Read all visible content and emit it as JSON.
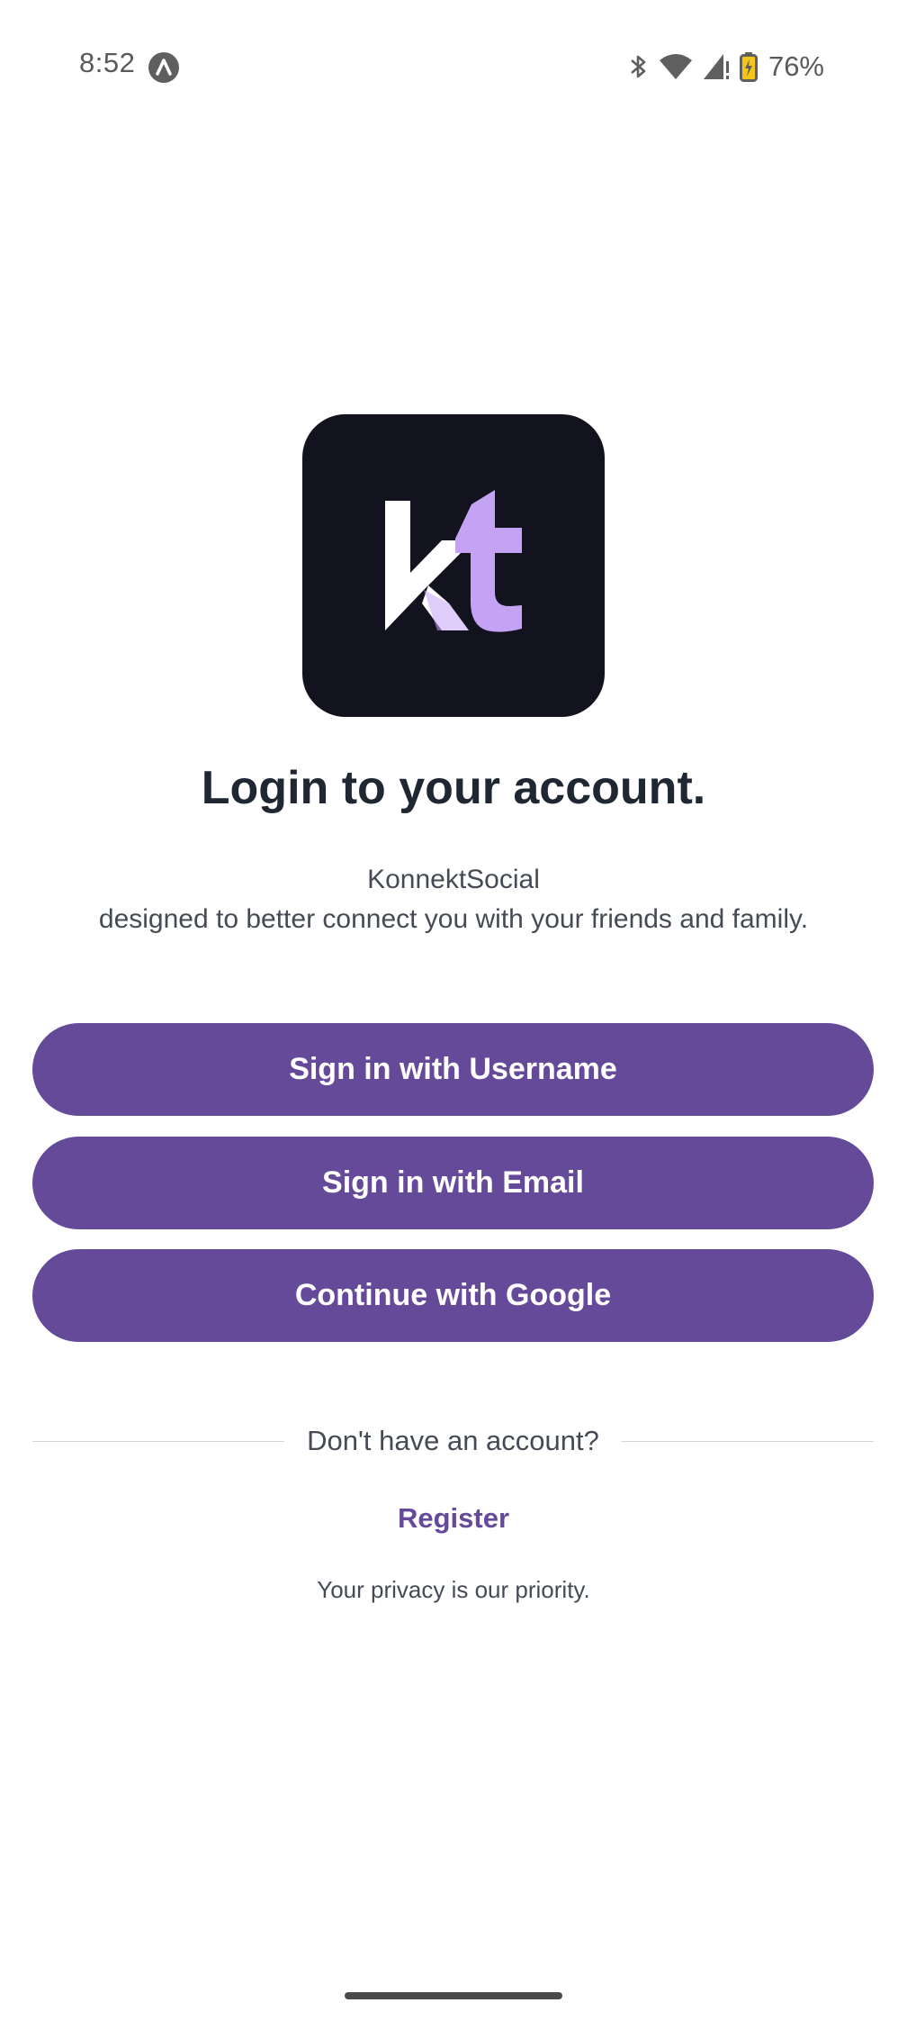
{
  "status_bar": {
    "time": "8:52",
    "battery_percent": "76%",
    "icons": [
      "app-notification-icon",
      "bluetooth-icon",
      "wifi-icon",
      "cellular-signal-icon",
      "battery-charging-icon"
    ]
  },
  "logo": {
    "letters": "kt",
    "colors": {
      "background": "#13121f",
      "k": "#ffffff",
      "t": "#c4a3f5"
    }
  },
  "title": "Login to your account.",
  "tagline": {
    "line1": "KonnektSocial",
    "line2": "designed to better connect you with your friends and family."
  },
  "buttons": {
    "username": "Sign in with Username",
    "email": "Sign in with Email",
    "google": "Continue with Google"
  },
  "divider_text": "Don't have an account?",
  "register_label": "Register",
  "privacy_note": "Your privacy is our priority.",
  "colors": {
    "accent": "#654a9a",
    "text_primary": "#1f2733",
    "text_secondary": "#454b55"
  }
}
